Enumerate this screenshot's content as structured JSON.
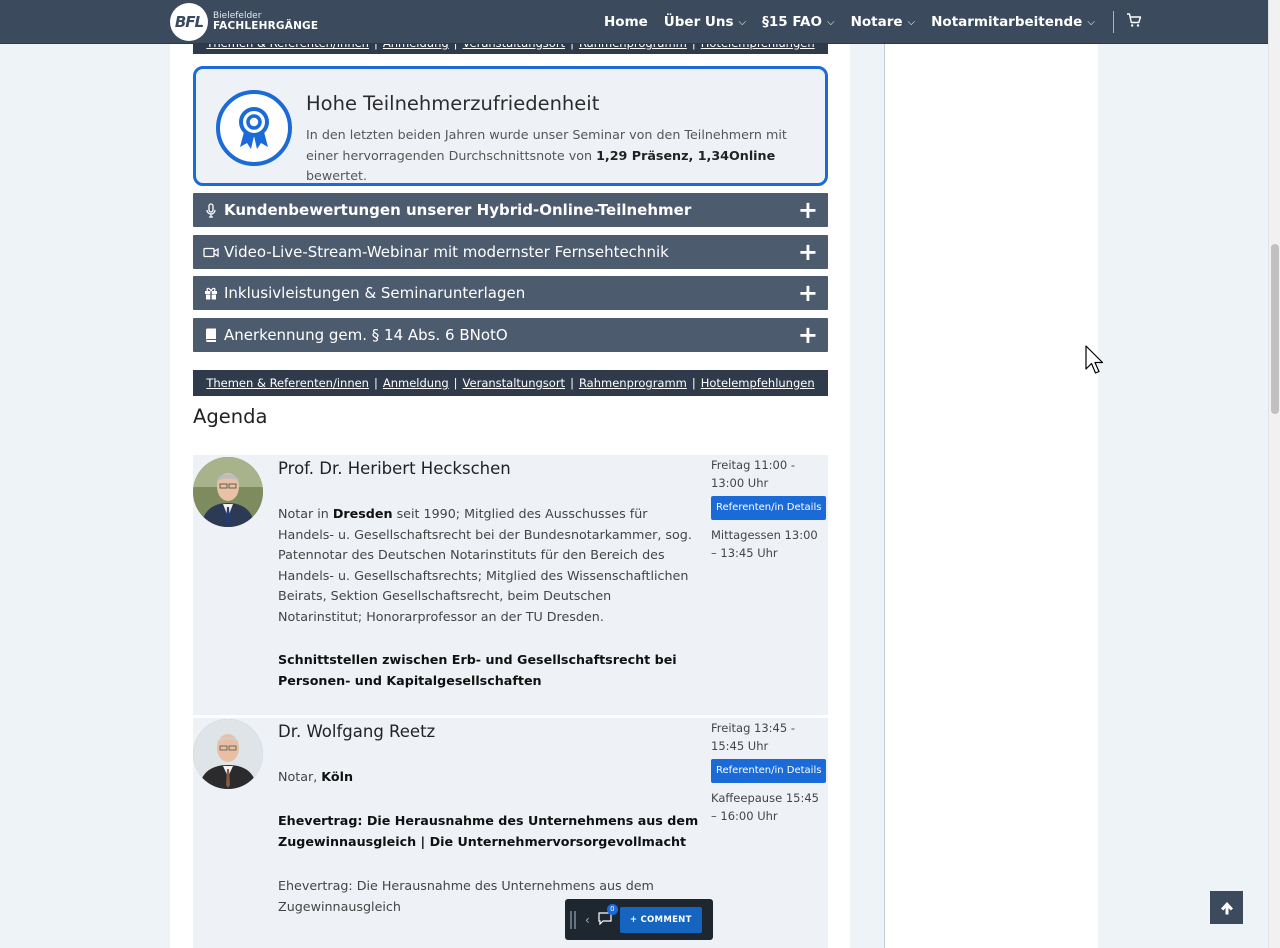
{
  "header": {
    "logo_badge": "BFL",
    "logo_line1": "Bielefelder",
    "logo_line2": "FACHLEHRGÄNGE",
    "nav": [
      {
        "label": "Home",
        "dropdown": false
      },
      {
        "label": "Über Uns",
        "dropdown": true
      },
      {
        "label": "§15 FAO",
        "dropdown": true
      },
      {
        "label": "Notare",
        "dropdown": true
      },
      {
        "label": "Notarmitarbeitende",
        "dropdown": true
      }
    ],
    "cart_icon": "cart-icon"
  },
  "links": [
    "Themen & Referenten/innen",
    "Anmeldung",
    "Veranstaltungsort",
    "Rahmenprogramm",
    "Hotelempfehlungen"
  ],
  "highlight": {
    "icon": "award-ribbon-icon",
    "title": "Hohe Teilnehmerzufriedenheit",
    "text_before": "In den letzten beiden Jahren wurde unser Seminar von den Teilnehmern mit einer hervorragenden Durchschnittsnote von ",
    "text_bold": "1,29 Präsenz, 1,34Online",
    "text_after": " bewertet."
  },
  "accordions": [
    {
      "icon": "microphone-icon",
      "label": "Kundenbewertungen unserer Hybrid-Online-Teilnehmer",
      "bold": true
    },
    {
      "icon": "video-camera-icon",
      "label": "Video-Live-Stream-Webinar mit modernster Fernsehtechnik",
      "bold": false
    },
    {
      "icon": "gift-icon",
      "label": "Inklusivleistungen & Seminarunterlagen",
      "bold": false
    },
    {
      "icon": "book-icon",
      "label": "Anerkennung gem. § 14 Abs. 6 BNotO",
      "bold": false
    }
  ],
  "agenda": {
    "title": "Agenda",
    "speakers": [
      {
        "name": "Prof. Dr. Heribert Heckschen",
        "bio_prefix": "Notar in ",
        "bio_bold": "Dresden",
        "bio_rest": " seit 1990; Mitglied des Ausschusses für Handels- u. Gesellschaftsrecht bei der Bundesnotarkammer, sog. Patennotar des Deutschen Notarinstituts für den Bereich des Handels- u. Gesellschaftsrechts; Mitglied des Wissenschaftlichen Beirats, Sektion Gesellschaftsrecht, beim Deutschen Notarinstitut; Honorarprofessor an der TU Dresden.",
        "topic": "Schnittstellen zwischen Erb- und Gesellschaftsrecht bei Personen- und Kapitalgesellschaften",
        "time": "Freitag 11:00 - 13:00 Uhr",
        "button": "Referenten/in Details",
        "break": "Mittagessen 13:00 – 13:45 Uhr"
      },
      {
        "name": "Dr. Wolfgang Reetz",
        "bio_prefix": "Notar, ",
        "bio_bold": "Köln",
        "topic": "Ehevertrag: Die Herausnahme des Unternehmens aus dem Zugewinnausgleich | Die Unternehmervorsorgevollmacht",
        "extra": "Ehevertrag: Die Herausnahme des Unternehmens aus dem Zugewinnausgleich",
        "time": "Freitag 13:45 - 15:45 Uhr",
        "button": "Referenten/in Details",
        "break": "Kaffeepause 15:45 – 16:00 Uhr"
      }
    ]
  },
  "comment_toolbar": {
    "badge": "0",
    "button": "+ COMMENT"
  },
  "colors": {
    "nav_bg": "#3c4a5e",
    "accent": "#1a6bd8",
    "accordion_bg": "#4d5b6f",
    "linkbar_bg": "#2f3a4b"
  }
}
